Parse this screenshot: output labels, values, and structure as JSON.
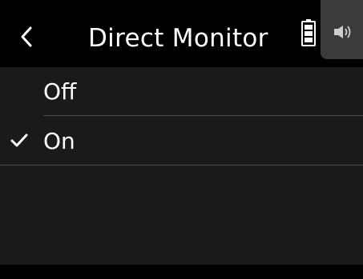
{
  "header": {
    "title": "Direct Monitor",
    "back_icon": "chevron-left-icon",
    "battery_icon": "battery-icon",
    "speaker_icon": "speaker-icon"
  },
  "options": [
    {
      "label": "Off",
      "selected": false
    },
    {
      "label": "On",
      "selected": true
    }
  ],
  "colors": {
    "header_bg": "#000000",
    "list_bg": "#1a1a1a",
    "text": "#ffffff",
    "divider": "#4a4a4a",
    "speaker_tab_bg": "#3b3b3b"
  }
}
